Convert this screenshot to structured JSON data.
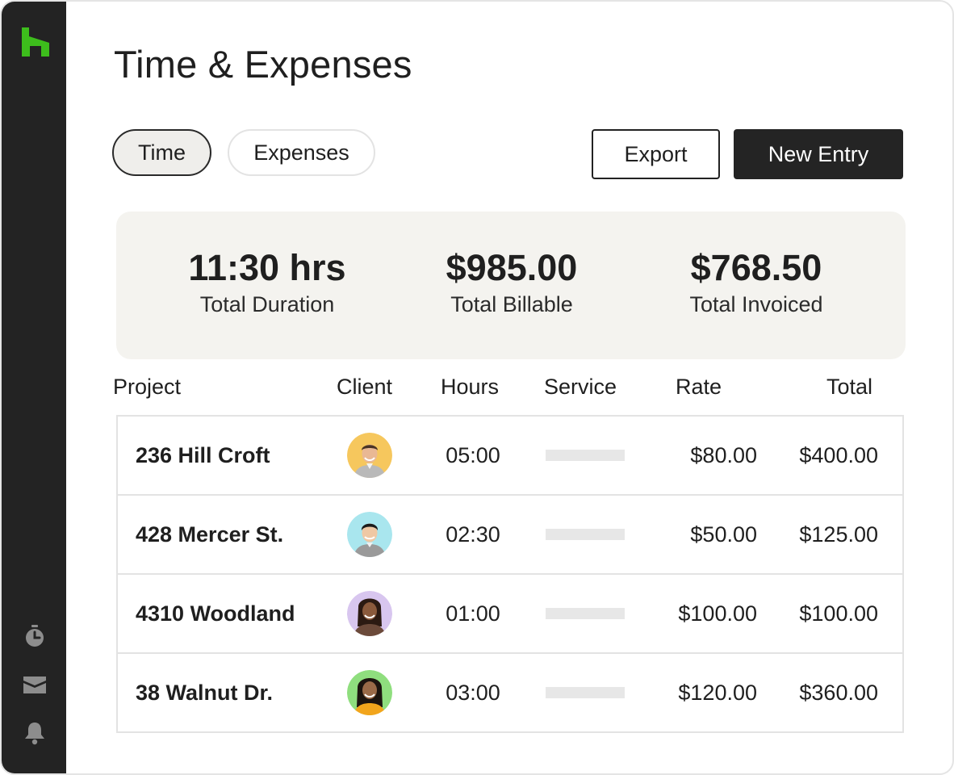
{
  "app": {
    "title": "Time & Expenses"
  },
  "sidebar": {
    "icons": [
      "home-logo-icon",
      "stopwatch-icon",
      "inbox-icon",
      "bell-icon"
    ]
  },
  "tabs": [
    {
      "label": "Time",
      "active": true
    },
    {
      "label": "Expenses",
      "active": false
    }
  ],
  "actions": {
    "export_label": "Export",
    "new_entry_label": "New Entry"
  },
  "summary": [
    {
      "value": "11:30 hrs",
      "label": "Total Duration"
    },
    {
      "value": "$985.00",
      "label": "Total Billable"
    },
    {
      "value": "$768.50",
      "label": "Total Invoiced"
    }
  ],
  "table": {
    "columns": [
      "Project",
      "Client",
      "Hours",
      "Service",
      "Rate",
      "Total"
    ],
    "rows": [
      {
        "project": "236 Hill Croft",
        "client_avatar": "avatar-man-yellow",
        "hours": "05:00",
        "rate": "$80.00",
        "total": "$400.00"
      },
      {
        "project": "428 Mercer St.",
        "client_avatar": "avatar-man-blue",
        "hours": "02:30",
        "rate": "$50.00",
        "total": "$125.00"
      },
      {
        "project": "4310 Woodland",
        "client_avatar": "avatar-woman-purple",
        "hours": "01:00",
        "rate": "$100.00",
        "total": "$100.00"
      },
      {
        "project": "38 Walnut Dr.",
        "client_avatar": "avatar-woman-green",
        "hours": "03:00",
        "rate": "$120.00",
        "total": "$360.00"
      }
    ]
  },
  "colors": {
    "brand_green": "#3dbd1c",
    "sidebar_bg": "#232323",
    "summary_bg": "#f4f3ef",
    "primary_button_bg": "#242424"
  }
}
